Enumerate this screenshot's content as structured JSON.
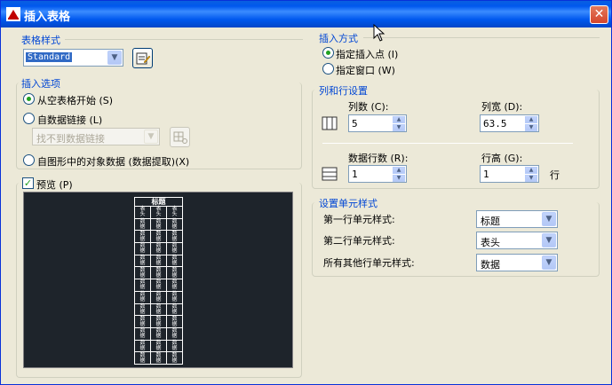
{
  "window": {
    "title": "插入表格"
  },
  "table_style": {
    "group_title": "表格样式",
    "combo_value": "Standard"
  },
  "insert_options": {
    "group_title": "插入选项",
    "radio_empty": "从空表格开始 (S)",
    "radio_datalink": "自数据链接 (L)",
    "datalink_combo": "找不到数据链接",
    "radio_extract": "自图形中的对象数据 (数据提取)(X)"
  },
  "preview": {
    "checkbox_label": "预览 (P)",
    "table_title": "标题",
    "header_cells": [
      "表头",
      "表头",
      "表头"
    ],
    "data_cell": "数据",
    "data_rows": 12
  },
  "insert_method": {
    "group_title": "插入方式",
    "radio_point": "指定插入点 (I)",
    "radio_window": "指定窗口 (W)"
  },
  "columns_rows": {
    "group_title": "列和行设置",
    "columns_label": "列数 (C):",
    "columns_value": "5",
    "column_width_label": "列宽 (D):",
    "column_width_value": "63.5",
    "data_rows_label": "数据行数 (R):",
    "data_rows_value": "1",
    "row_height_label": "行高 (G):",
    "row_height_value": "1",
    "row_unit": "行"
  },
  "cell_styles": {
    "group_title": "设置单元样式",
    "first_row_label": "第一行单元样式:",
    "first_row_value": "标题",
    "second_row_label": "第二行单元样式:",
    "second_row_value": "表头",
    "other_rows_label": "所有其他行单元样式:",
    "other_rows_value": "数据"
  }
}
